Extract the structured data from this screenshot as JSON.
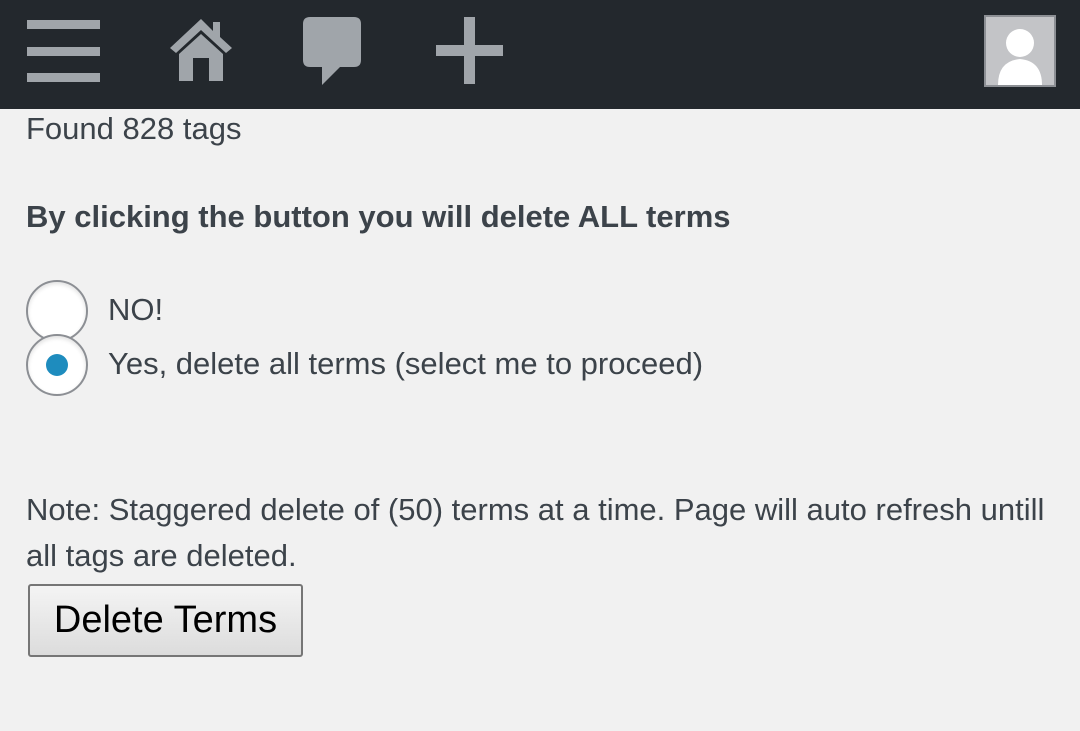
{
  "adminbar": {
    "icons": [
      "menu-icon",
      "home-icon",
      "comment-icon",
      "plus-icon",
      "avatar"
    ],
    "background": "#23282d",
    "icon_color": "#a0a5aa"
  },
  "main": {
    "found_text": "Found 828 tags",
    "warning_text": "By clicking the button you will delete ALL terms",
    "options": [
      {
        "label": "NO!",
        "selected": false
      },
      {
        "label": "Yes, delete all terms (select me to proceed)",
        "selected": true
      }
    ],
    "note_text": "Note: Staggered delete of (50) terms at a time. Page will auto refresh untill all tags are deleted.",
    "delete_button_label": "Delete Terms",
    "radio_selected_color": "#1e8cbe"
  }
}
